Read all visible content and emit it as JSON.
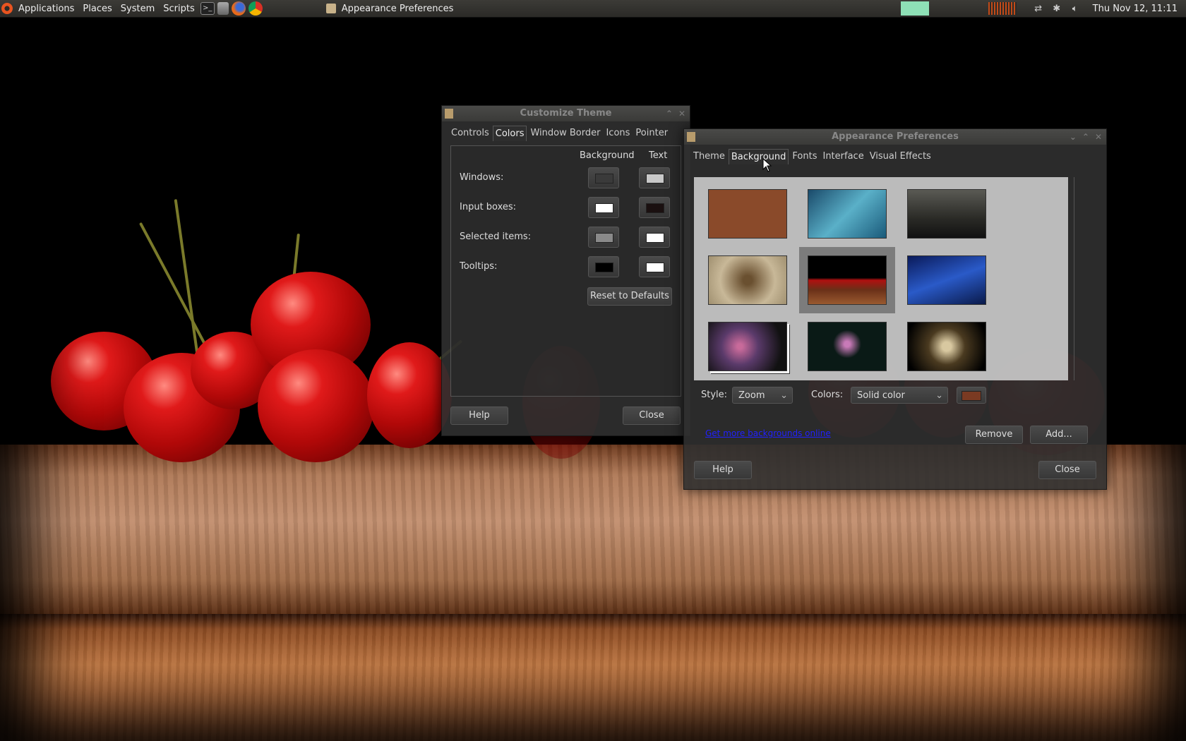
{
  "top_panel": {
    "menus": [
      "Applications",
      "Places",
      "System",
      "Scripts"
    ],
    "launchers": [
      "terminal-icon",
      "calculator-icon",
      "firefox-icon",
      "chrome-icon"
    ],
    "active_window": "Appearance Preferences",
    "clock": "Thu Nov 12, 11:11",
    "colors": {
      "sysmon": "#8ee0b6",
      "netgraph": "#c24a18"
    }
  },
  "customize_theme": {
    "title": "Customize Theme",
    "tabs": [
      "Controls",
      "Colors",
      "Window Border",
      "Icons",
      "Pointer"
    ],
    "active_tab": "Colors",
    "column_background": "Background",
    "column_text": "Text",
    "rows": [
      {
        "label": "Windows:",
        "bg": "#3a3a3a",
        "text": "#c8c8c8"
      },
      {
        "label": "Input boxes:",
        "bg": "#ffffff",
        "text": "#1a1010"
      },
      {
        "label": "Selected items:",
        "bg": "#8a8a8a",
        "text": "#ffffff"
      },
      {
        "label": "Tooltips:",
        "bg": "#000000",
        "text": "#ffffff"
      }
    ],
    "reset_button": "Reset to Defaults",
    "help_button": "Help",
    "close_button": "Close"
  },
  "appearance": {
    "title": "Appearance Preferences",
    "tabs": [
      "Theme",
      "Background",
      "Fonts",
      "Interface",
      "Visual Effects"
    ],
    "active_tab": "Background",
    "thumbnails": [
      {
        "name": "solid-brown",
        "color": "#8a4a2a"
      },
      {
        "name": "agave-leaves",
        "color": "#3c8aa6"
      },
      {
        "name": "dark-landscape",
        "color": "#3a3a36"
      },
      {
        "name": "dry-grass",
        "color": "#b8a888"
      },
      {
        "name": "cherries",
        "color": "#4a1a10",
        "selected": true
      },
      {
        "name": "night-sky",
        "color": "#1a3a8a"
      },
      {
        "name": "nebula",
        "color": "#5a3a5a"
      },
      {
        "name": "water-lily",
        "color": "#0a1a16"
      },
      {
        "name": "hands",
        "color": "#4a3a20"
      }
    ],
    "style_label": "Style:",
    "style_value": "Zoom",
    "colors_label": "Colors:",
    "colors_value": "Solid color",
    "color_swatch": "#7a3a22",
    "link_text": "Get more backgrounds online",
    "remove_button": "Remove",
    "add_button": "Add...",
    "help_button": "Help",
    "close_button": "Close"
  }
}
